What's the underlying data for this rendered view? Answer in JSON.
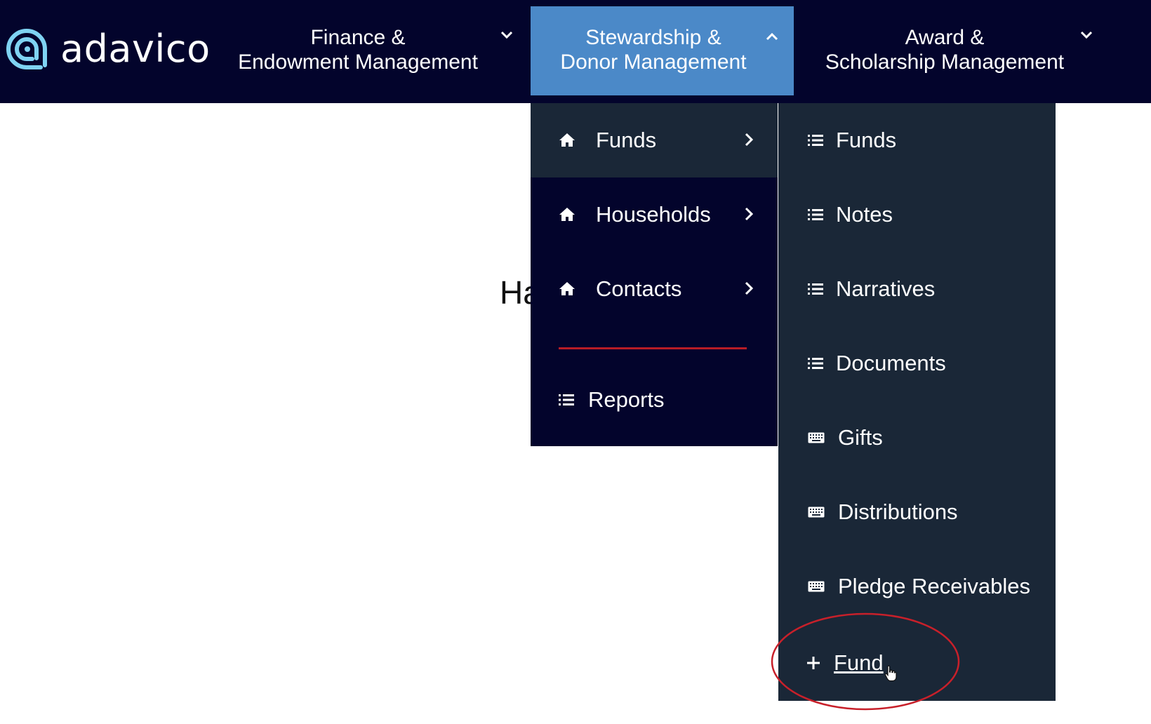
{
  "app": {
    "logo_text": "adavico",
    "logo_icon": "adavico-swirl-logo"
  },
  "nav": {
    "finance": {
      "line1": "Finance &",
      "line2": "Endowment Management"
    },
    "stewardship": {
      "line1": "Stewardship &",
      "line2": "Donor Management"
    },
    "award": {
      "line1": "Award &",
      "line2": "Scholarship Management"
    }
  },
  "background_text": "Ha",
  "submenu": {
    "items": [
      {
        "label": "Funds",
        "icon": "home-icon"
      },
      {
        "label": "Households",
        "icon": "home-icon"
      },
      {
        "label": "Contacts",
        "icon": "home-icon"
      }
    ],
    "reports_label": "Reports"
  },
  "flyout": {
    "items": [
      {
        "label": "Funds",
        "icon": "list-icon"
      },
      {
        "label": "Notes",
        "icon": "list-icon"
      },
      {
        "label": "Narratives",
        "icon": "list-icon"
      },
      {
        "label": "Documents",
        "icon": "list-icon"
      },
      {
        "label": "Gifts",
        "icon": "keyboard-icon"
      },
      {
        "label": "Distributions",
        "icon": "keyboard-icon"
      },
      {
        "label": "Pledge Receivables",
        "icon": "keyboard-icon"
      }
    ],
    "add_label": "Fund",
    "add_icon": "plus-icon"
  },
  "colors": {
    "topbar": "#03042c",
    "active_nav": "#4b89c8",
    "flyout_bg": "#1a2737",
    "divider": "#b81c26",
    "highlight": "#c8202a"
  }
}
